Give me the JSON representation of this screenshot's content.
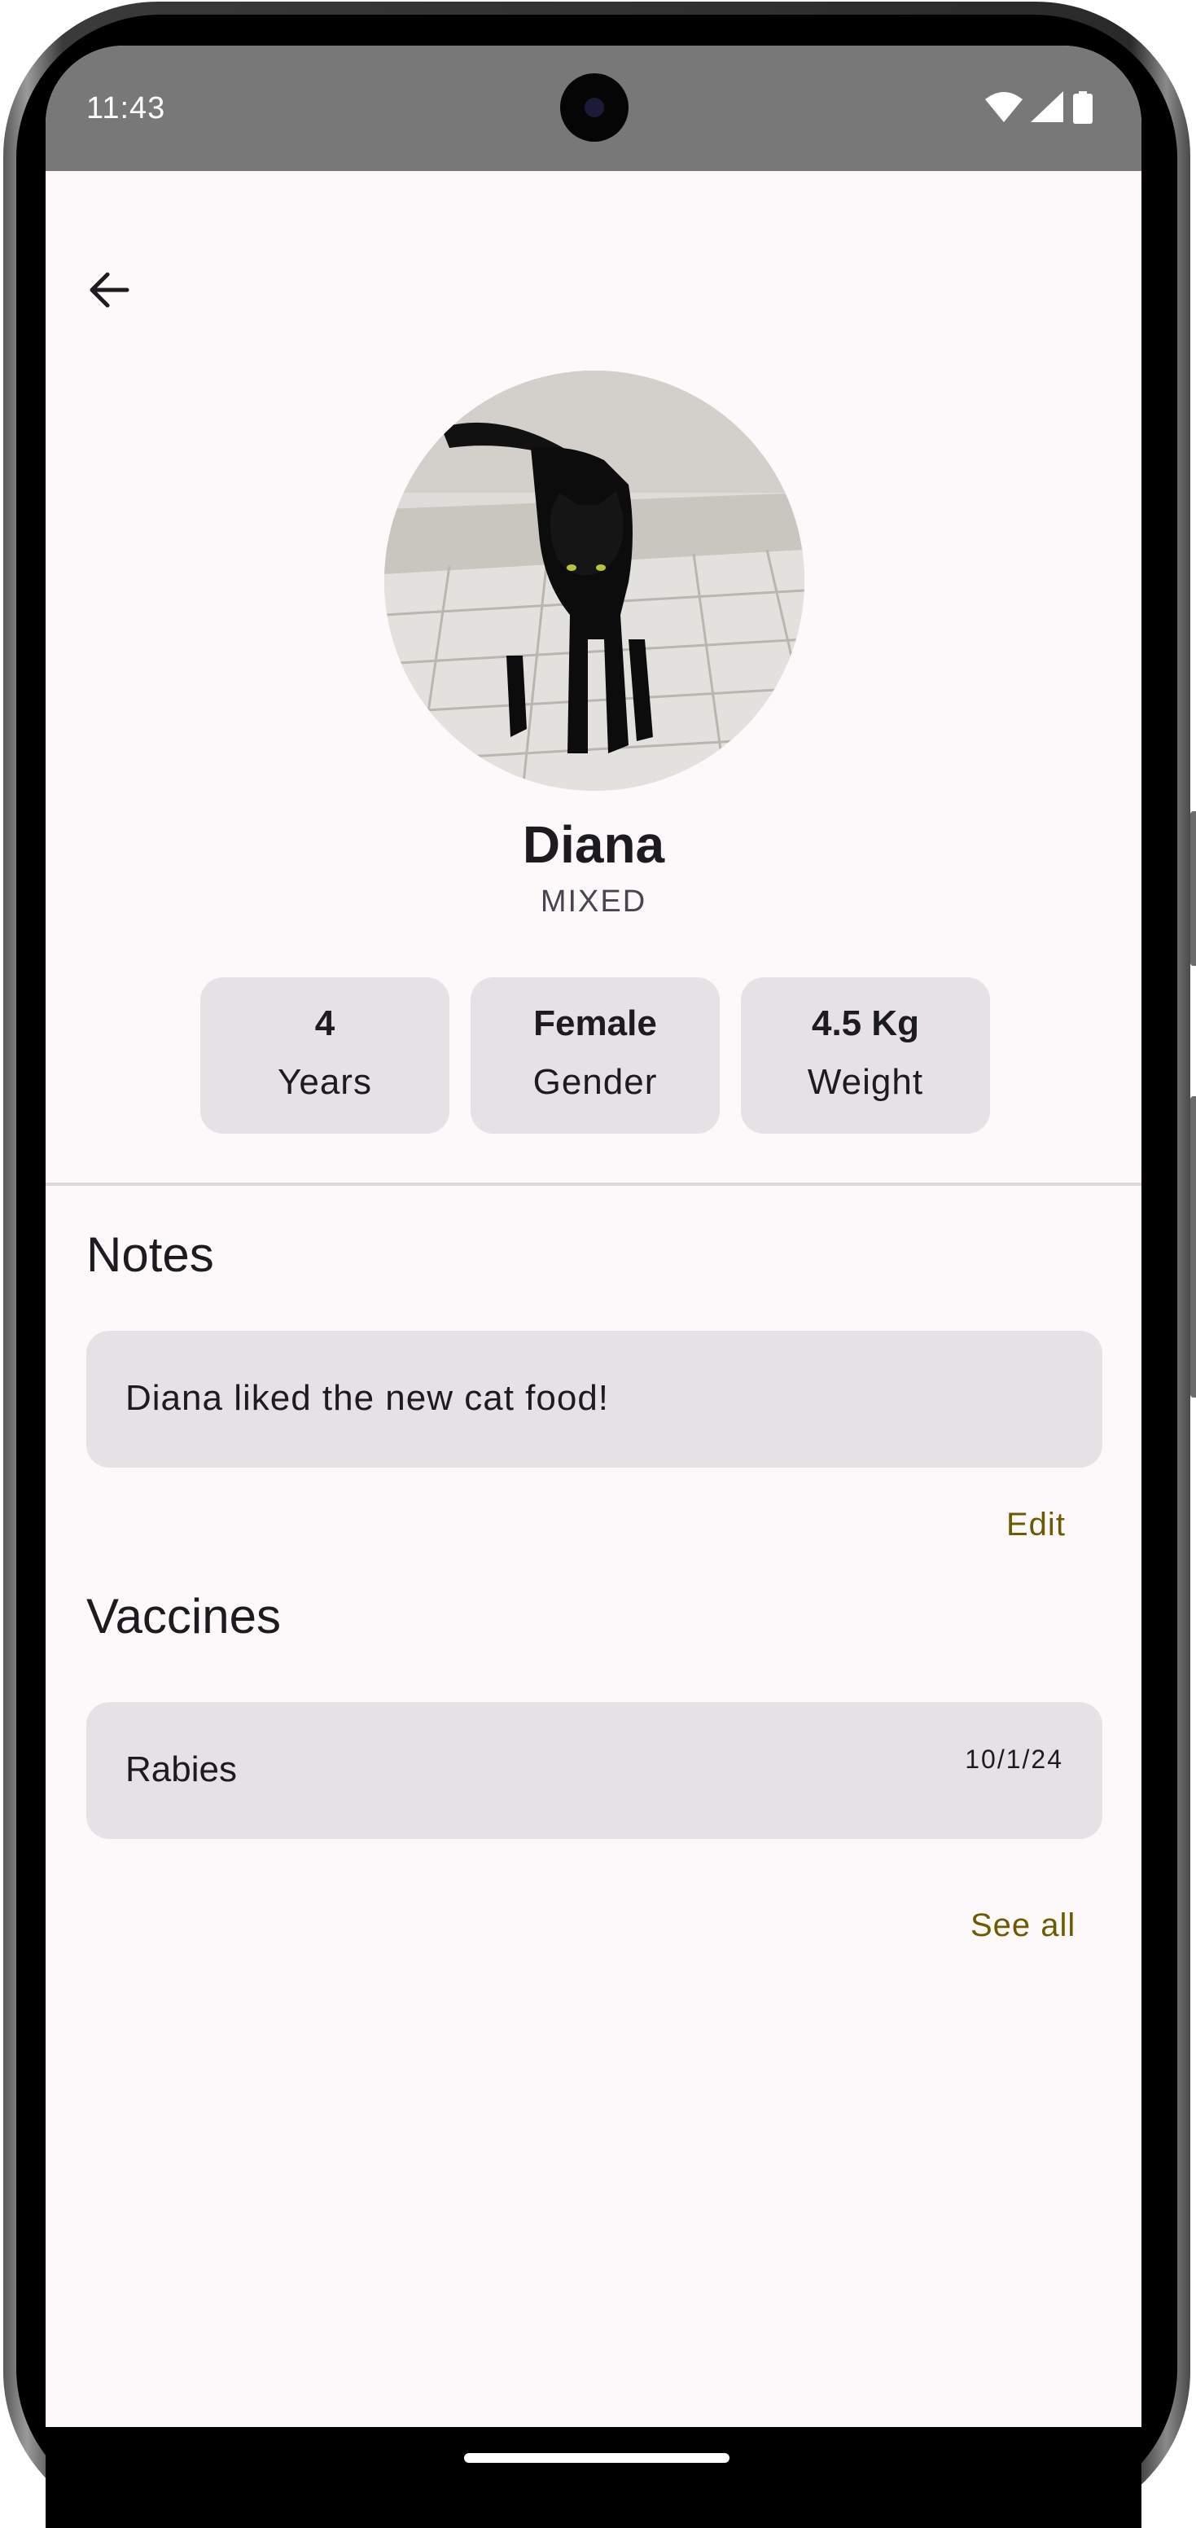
{
  "status_bar": {
    "time": "11:43",
    "icons": [
      "wifi-icon",
      "cellular-signal-icon",
      "battery-icon"
    ]
  },
  "top_bar": {
    "back_icon": "arrow-back-icon"
  },
  "pet": {
    "name": "Diana",
    "breed": "MIXED",
    "photo_description_icon": "black-cat-photo"
  },
  "stats": [
    {
      "value": "4",
      "label": "Years"
    },
    {
      "value": "Female",
      "label": "Gender"
    },
    {
      "value": "4.5 Kg",
      "label": "Weight"
    }
  ],
  "notes": {
    "title": "Notes",
    "text": "Diana liked the new cat food!",
    "edit_label": "Edit"
  },
  "vaccines": {
    "title": "Vaccines",
    "items": [
      {
        "name": "Rabies",
        "date": "10/1/24"
      }
    ],
    "see_all_label": "See all"
  },
  "colors": {
    "background": "#fdf8fa",
    "card": "#e6e1e5",
    "accent_text": "#6e5a00",
    "status_bar": "#787878"
  }
}
